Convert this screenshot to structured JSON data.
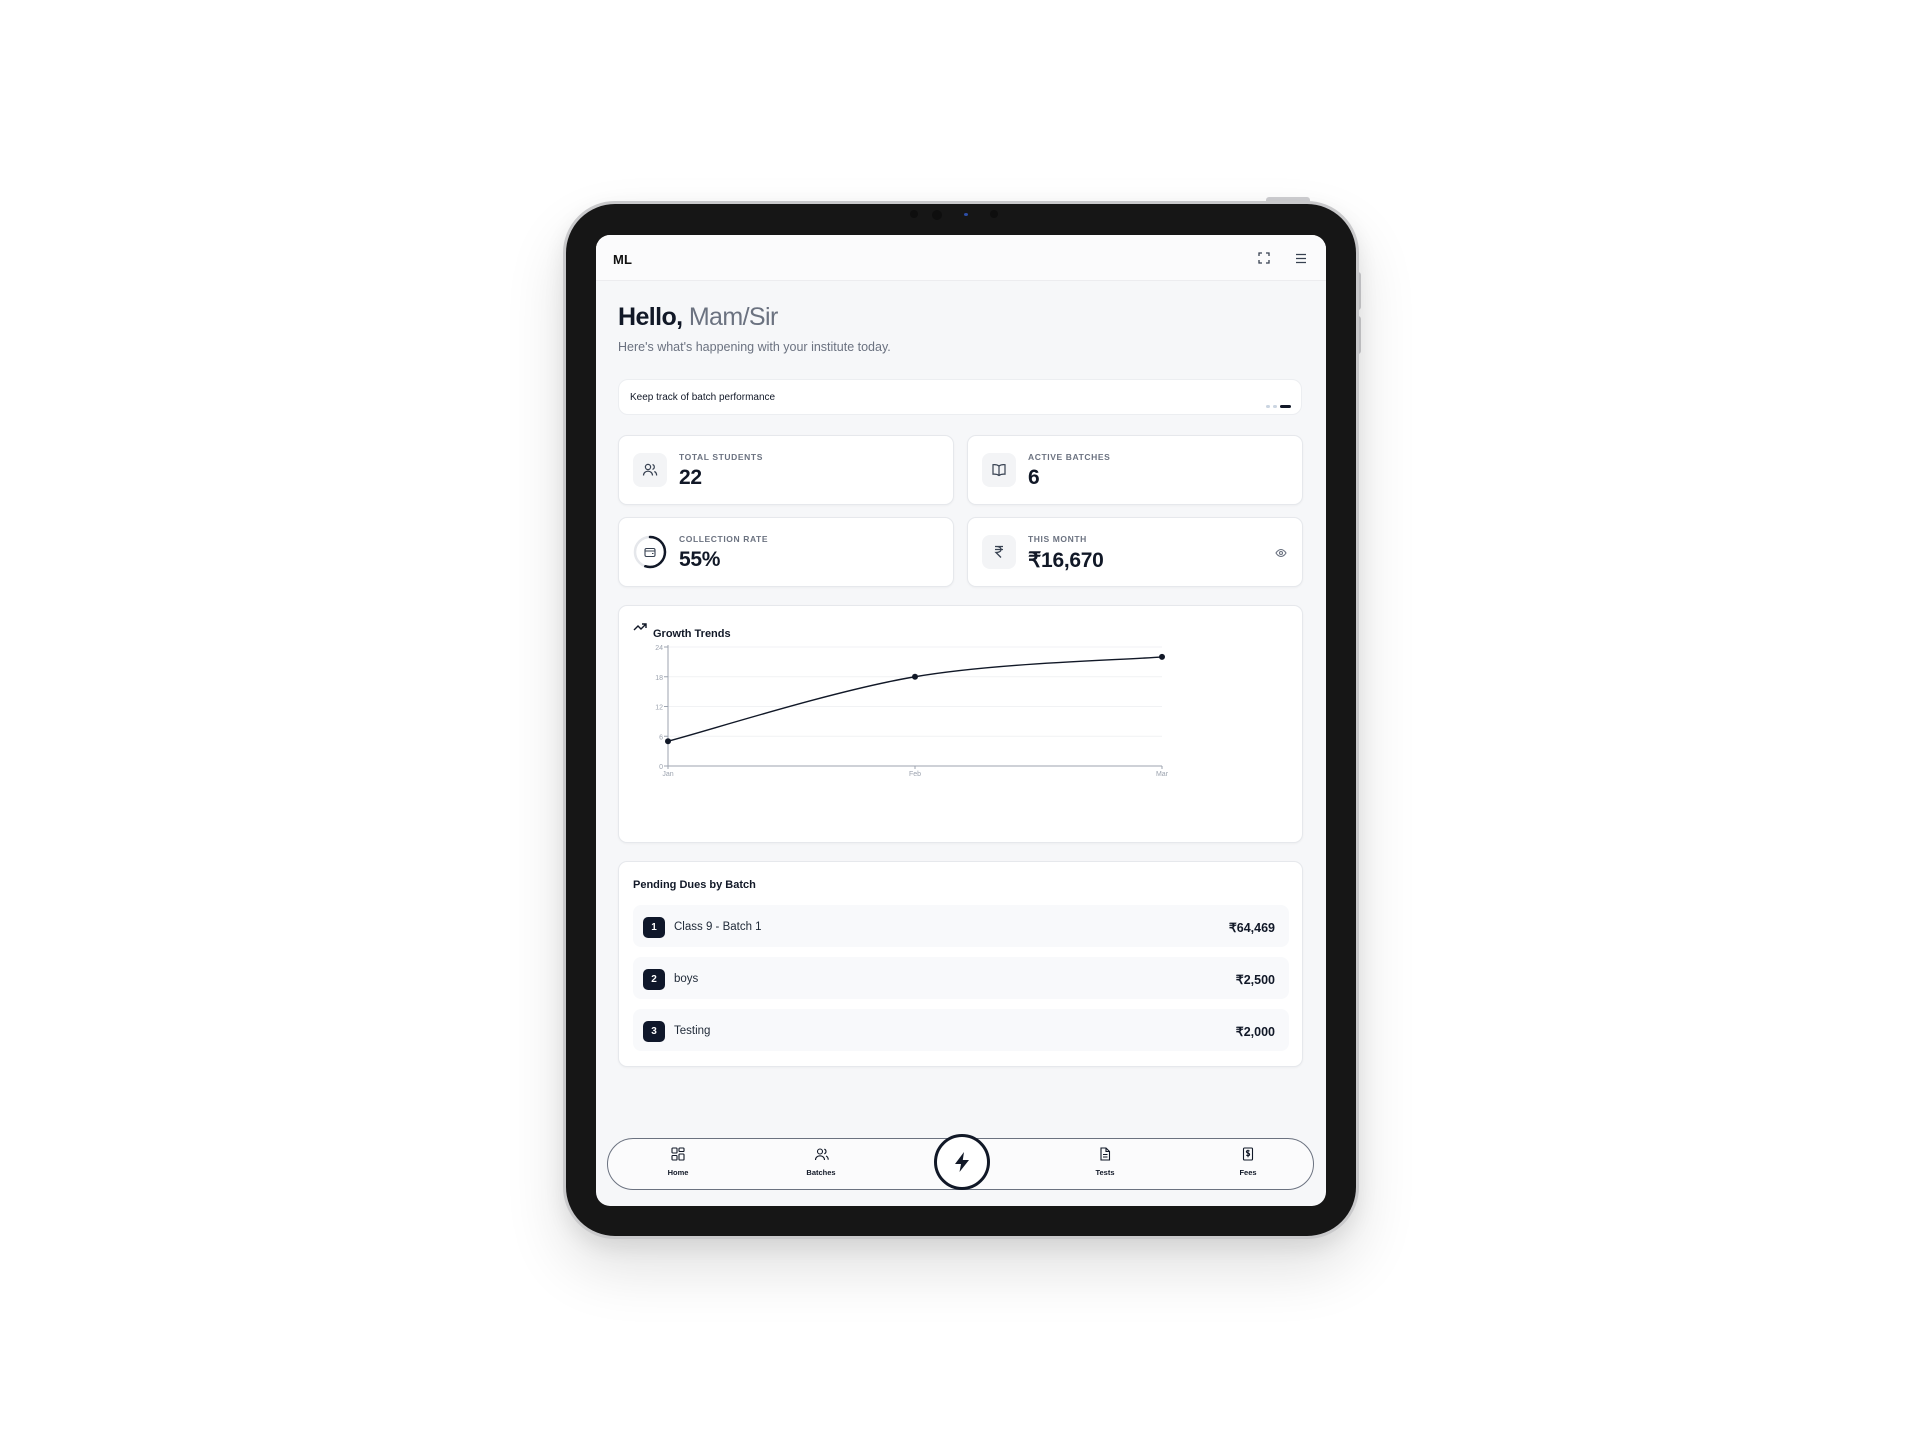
{
  "app": {
    "brand": "ML"
  },
  "header": {
    "fullscreen_icon": "expand-icon",
    "menu_icon": "hamburger-menu-icon"
  },
  "greeting": {
    "hello": "Hello,",
    "name": "Mam/Sir",
    "subtitle": "Here's what's happening with your institute today."
  },
  "banner": {
    "text": "Keep track of batch performance",
    "slides": 3,
    "active_slide": 3
  },
  "stats": {
    "total_students": {
      "label": "TOTAL STUDENTS",
      "value": "22",
      "icon": "users-icon"
    },
    "active_batches": {
      "label": "ACTIVE BATCHES",
      "value": "6",
      "icon": "book-open-icon"
    },
    "collection_rate": {
      "label": "COLLECTION RATE",
      "value": "55%",
      "fraction": 0.55,
      "icon": "wallet-icon"
    },
    "this_month": {
      "label": "THIS MONTH",
      "value": "₹16,670",
      "icon": "rupee-icon",
      "action_icon": "eye-icon"
    }
  },
  "chart_data": {
    "type": "line",
    "title": "Growth Trends",
    "categories": [
      "Jan",
      "Feb",
      "Mar"
    ],
    "series": [
      {
        "values": [
          5,
          18,
          22
        ]
      }
    ],
    "yticks": [
      0,
      6,
      12,
      18,
      24
    ],
    "ylim": [
      0,
      24
    ],
    "color": "#111827"
  },
  "pending": {
    "title": "Pending Dues by Batch",
    "rows": [
      {
        "rank": "1",
        "name": "Class 9 - Batch 1",
        "amount": "₹64,469"
      },
      {
        "rank": "2",
        "name": "boys",
        "amount": "₹2,500"
      },
      {
        "rank": "3",
        "name": "Testing",
        "amount": "₹2,000"
      }
    ]
  },
  "nav": {
    "home": "Home",
    "batches": "Batches",
    "tests": "Tests",
    "fees": "Fees",
    "fab_icon": "lightning-icon"
  }
}
